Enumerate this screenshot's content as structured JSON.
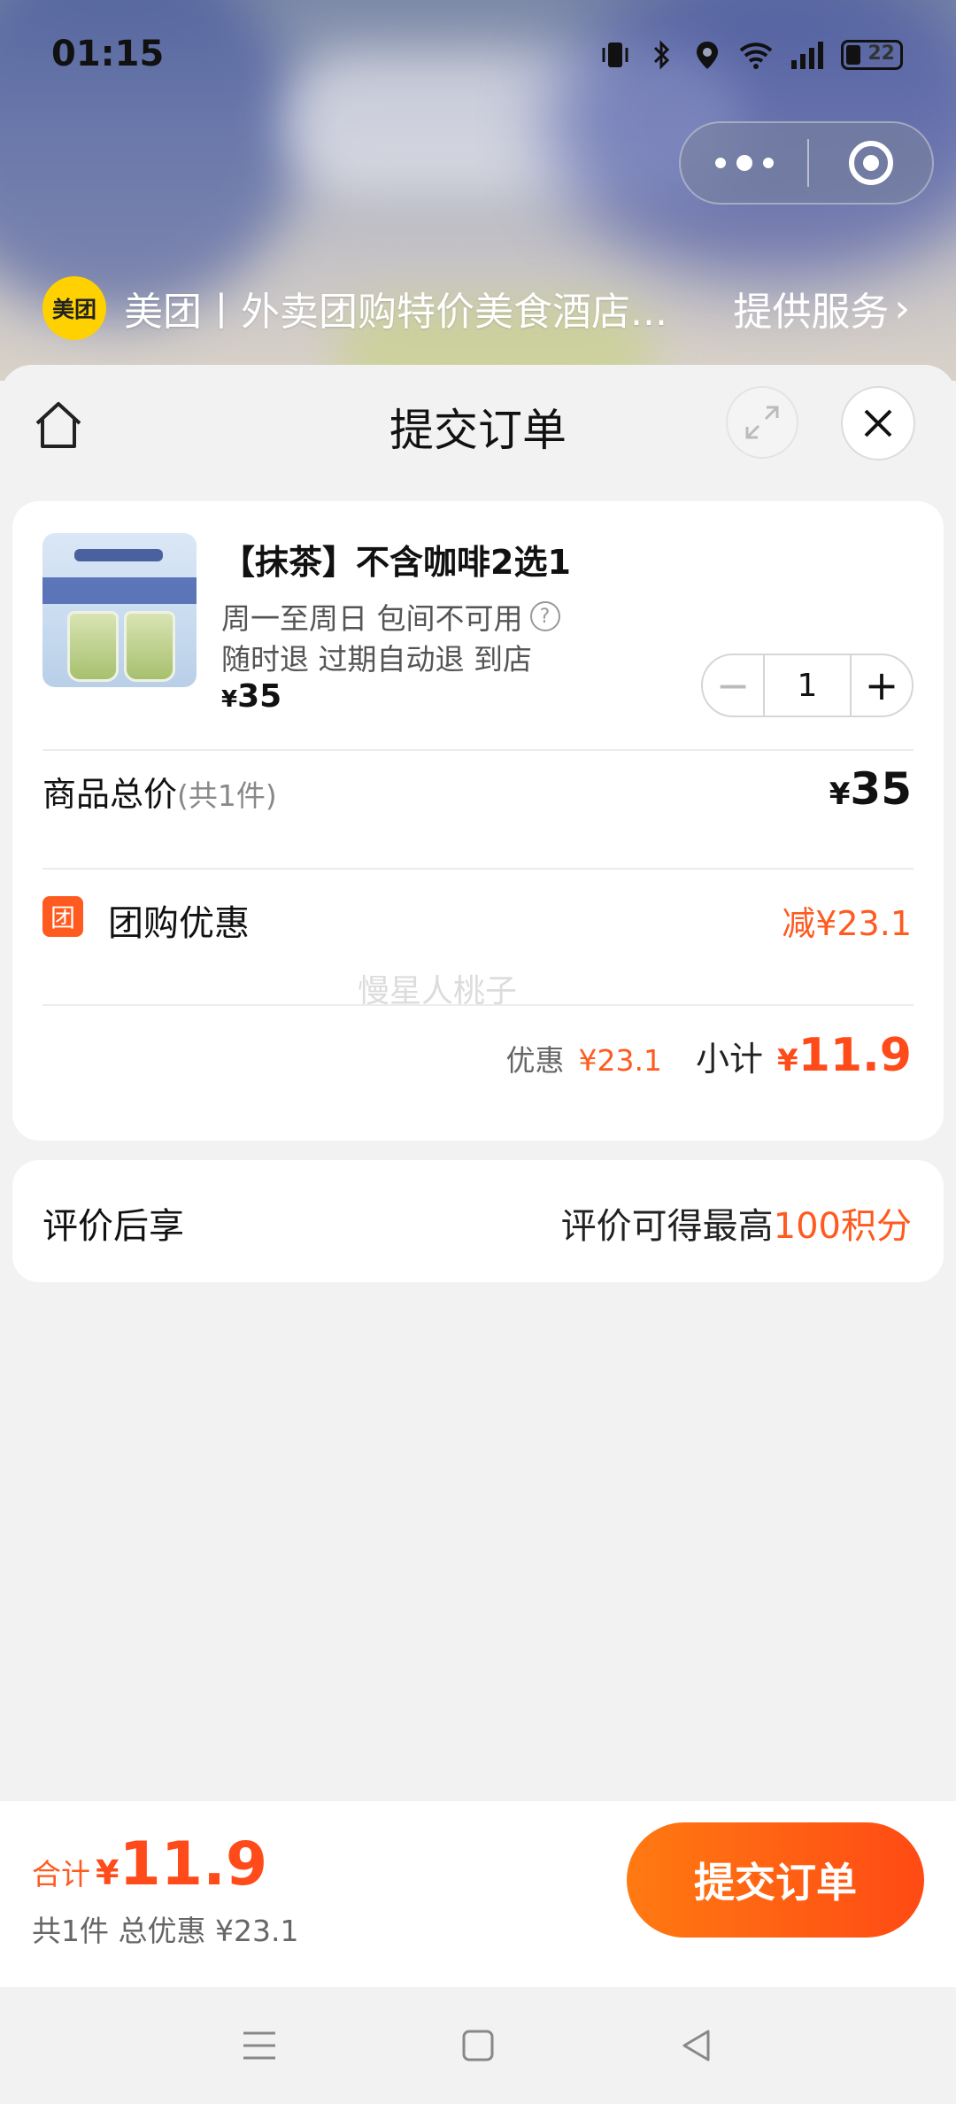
{
  "status_bar": {
    "time": "01:15",
    "battery_level": "22"
  },
  "mini_program": {
    "logo_text": "美团",
    "name": "美团丨外卖团购特价美食酒店...",
    "service_label": "提供服务",
    "service_chevron": "›"
  },
  "sheet": {
    "title": "提交订单"
  },
  "product": {
    "title": "【抹茶】不含咖啡2选1",
    "line1": "周一至周日 包间不可用",
    "help_glyph": "?",
    "line2": "随时退 过期自动退 到店",
    "currency": "¥",
    "price": "35",
    "quantity": "1",
    "minus_glyph": "−",
    "plus_glyph": "+"
  },
  "summary": {
    "total_label": "商品总价",
    "total_count": "(共1件)",
    "total_currency": "¥",
    "total_price": "35",
    "coupon_badge": "团",
    "coupon_label": "团购优惠",
    "coupon_value": "减¥23.1",
    "watermark": "慢星人桃子",
    "discount_label": "优惠",
    "discount_value": "¥23.1",
    "subtotal_label": "小计",
    "subtotal_currency": "¥",
    "subtotal_value": "11.9"
  },
  "review": {
    "label": "评价后享",
    "value_prefix": "评价可得最高",
    "value_points": "100积分"
  },
  "bottom_bar": {
    "sum_label": "合计",
    "sum_currency": "¥",
    "sum_value": "11.9",
    "sum_sub": "共1件 总优惠 ¥23.1",
    "submit_label": "提交订单"
  },
  "colors": {
    "accent": "#ff5a1f",
    "brand_yellow": "#ffd100",
    "background": "#f2f2f2"
  },
  "icons": [
    "home-icon",
    "expand-icon",
    "close-icon",
    "help-icon",
    "menu-icon",
    "home-square-icon",
    "back-triangle-icon"
  ]
}
